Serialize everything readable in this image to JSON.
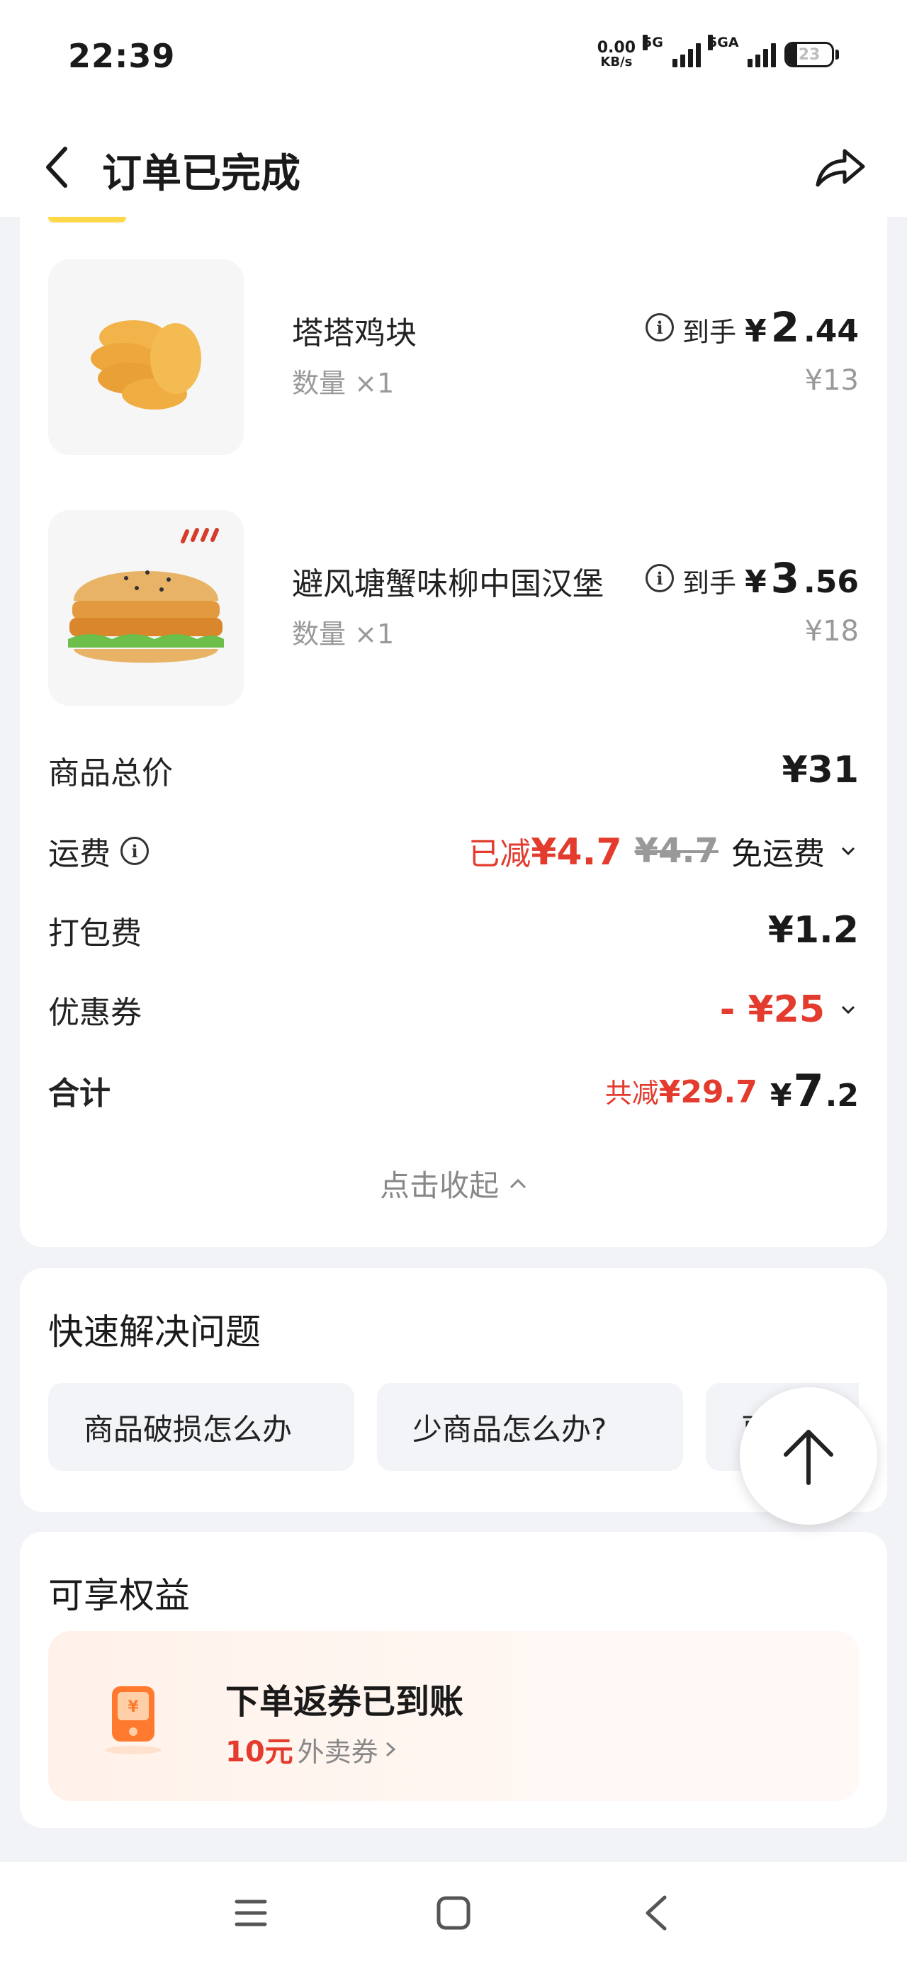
{
  "status_bar": {
    "time": "22:39",
    "net_speed": "0.00",
    "net_unit": "KB/s",
    "signal1_label": "5G",
    "signal2_label": "5GA",
    "battery": "23",
    "battery_level": 0.23
  },
  "header": {
    "title": "订单已完成",
    "back_icon": "chevron-left-icon",
    "share_icon": "share-icon"
  },
  "items": [
    {
      "name": "塔塔鸡块",
      "qty_label": "数量",
      "qty": "×1",
      "price_prefix": "到手",
      "currency": "¥",
      "price_int": "2",
      "price_dec": ".44",
      "original": "¥13"
    },
    {
      "name": "避风塘蟹味柳中国汉堡",
      "qty_label": "数量",
      "qty": "×1",
      "price_prefix": "到手",
      "currency": "¥",
      "price_int": "3",
      "price_dec": ".56",
      "original": "¥18"
    }
  ],
  "summary": {
    "goods_total_label": "商品总价",
    "goods_total": "¥31",
    "delivery_label": "运费",
    "delivery_reduced_prefix": "已减",
    "delivery_reduced": "¥4.7",
    "delivery_original": "¥4.7",
    "delivery_free": "免运费",
    "packing_label": "打包费",
    "packing": "¥1.2",
    "coupon_label": "优惠券",
    "coupon": "- ¥25",
    "total_label": "合计",
    "saved_prefix": "共减",
    "saved": "¥29.7",
    "total_currency": "¥",
    "total_int": "7",
    "total_dec": ".2",
    "collapse": "点击收起"
  },
  "quick": {
    "title": "快速解决问题",
    "chips": [
      "商品破损怎么办",
      "少商品怎么办?",
      "更多"
    ]
  },
  "benefits": {
    "title": "可享权益",
    "card_title": "下单返券已到账",
    "amount": "10元",
    "suffix": "外卖券"
  },
  "colors": {
    "accent_red": "#e33b2d",
    "highlight_yellow": "#ffd84a",
    "coupon_orange": "#ff7a2e"
  }
}
